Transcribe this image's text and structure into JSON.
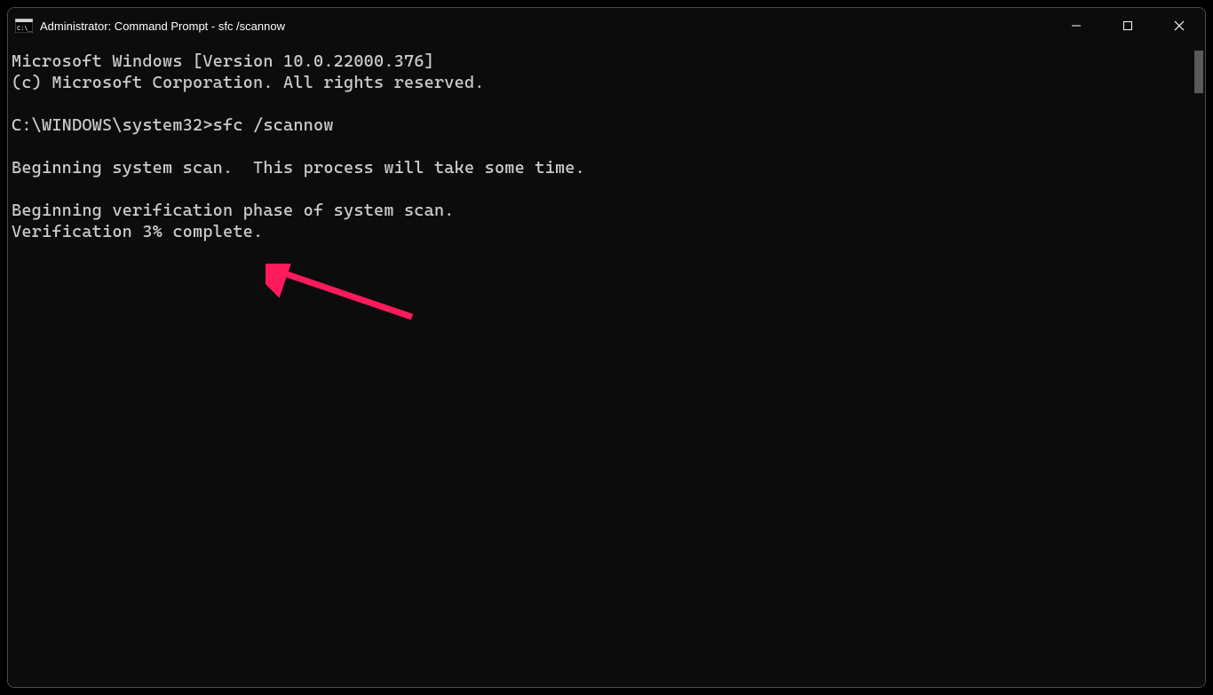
{
  "window": {
    "title": "Administrator: Command Prompt - sfc  /scannow"
  },
  "terminal": {
    "line1": "Microsoft Windows [Version 10.0.22000.376]",
    "line2": "(c) Microsoft Corporation. All rights reserved.",
    "blank1": "",
    "prompt_line": "C:\\WINDOWS\\system32>sfc /scannow",
    "blank2": "",
    "scan_line": "Beginning system scan.  This process will take some time.",
    "blank3": "",
    "verify_line": "Beginning verification phase of system scan.",
    "progress_line": "Verification 3% complete."
  },
  "colors": {
    "window_bg": "#0c0c0c",
    "text": "#cccccc",
    "border": "#4a4a4a",
    "arrow": "#ff1a5c"
  }
}
